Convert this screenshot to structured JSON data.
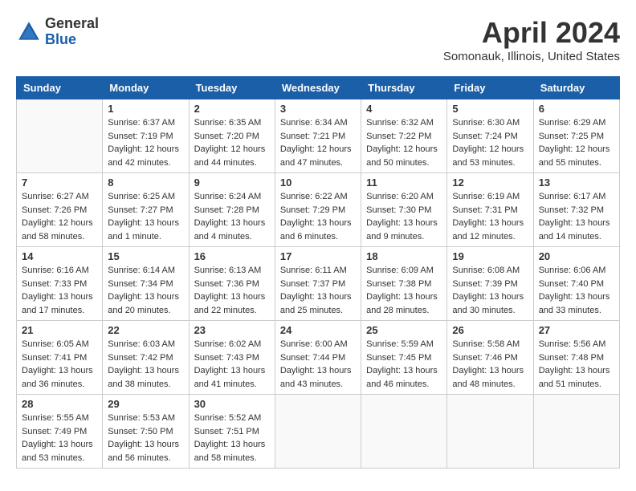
{
  "header": {
    "logo_general": "General",
    "logo_blue": "Blue",
    "month_title": "April 2024",
    "location": "Somonauk, Illinois, United States"
  },
  "days_of_week": [
    "Sunday",
    "Monday",
    "Tuesday",
    "Wednesday",
    "Thursday",
    "Friday",
    "Saturday"
  ],
  "weeks": [
    [
      {
        "day": "",
        "sunrise": "",
        "sunset": "",
        "daylight": ""
      },
      {
        "day": "1",
        "sunrise": "Sunrise: 6:37 AM",
        "sunset": "Sunset: 7:19 PM",
        "daylight": "Daylight: 12 hours and 42 minutes."
      },
      {
        "day": "2",
        "sunrise": "Sunrise: 6:35 AM",
        "sunset": "Sunset: 7:20 PM",
        "daylight": "Daylight: 12 hours and 44 minutes."
      },
      {
        "day": "3",
        "sunrise": "Sunrise: 6:34 AM",
        "sunset": "Sunset: 7:21 PM",
        "daylight": "Daylight: 12 hours and 47 minutes."
      },
      {
        "day": "4",
        "sunrise": "Sunrise: 6:32 AM",
        "sunset": "Sunset: 7:22 PM",
        "daylight": "Daylight: 12 hours and 50 minutes."
      },
      {
        "day": "5",
        "sunrise": "Sunrise: 6:30 AM",
        "sunset": "Sunset: 7:24 PM",
        "daylight": "Daylight: 12 hours and 53 minutes."
      },
      {
        "day": "6",
        "sunrise": "Sunrise: 6:29 AM",
        "sunset": "Sunset: 7:25 PM",
        "daylight": "Daylight: 12 hours and 55 minutes."
      }
    ],
    [
      {
        "day": "7",
        "sunrise": "Sunrise: 6:27 AM",
        "sunset": "Sunset: 7:26 PM",
        "daylight": "Daylight: 12 hours and 58 minutes."
      },
      {
        "day": "8",
        "sunrise": "Sunrise: 6:25 AM",
        "sunset": "Sunset: 7:27 PM",
        "daylight": "Daylight: 13 hours and 1 minute."
      },
      {
        "day": "9",
        "sunrise": "Sunrise: 6:24 AM",
        "sunset": "Sunset: 7:28 PM",
        "daylight": "Daylight: 13 hours and 4 minutes."
      },
      {
        "day": "10",
        "sunrise": "Sunrise: 6:22 AM",
        "sunset": "Sunset: 7:29 PM",
        "daylight": "Daylight: 13 hours and 6 minutes."
      },
      {
        "day": "11",
        "sunrise": "Sunrise: 6:20 AM",
        "sunset": "Sunset: 7:30 PM",
        "daylight": "Daylight: 13 hours and 9 minutes."
      },
      {
        "day": "12",
        "sunrise": "Sunrise: 6:19 AM",
        "sunset": "Sunset: 7:31 PM",
        "daylight": "Daylight: 13 hours and 12 minutes."
      },
      {
        "day": "13",
        "sunrise": "Sunrise: 6:17 AM",
        "sunset": "Sunset: 7:32 PM",
        "daylight": "Daylight: 13 hours and 14 minutes."
      }
    ],
    [
      {
        "day": "14",
        "sunrise": "Sunrise: 6:16 AM",
        "sunset": "Sunset: 7:33 PM",
        "daylight": "Daylight: 13 hours and 17 minutes."
      },
      {
        "day": "15",
        "sunrise": "Sunrise: 6:14 AM",
        "sunset": "Sunset: 7:34 PM",
        "daylight": "Daylight: 13 hours and 20 minutes."
      },
      {
        "day": "16",
        "sunrise": "Sunrise: 6:13 AM",
        "sunset": "Sunset: 7:36 PM",
        "daylight": "Daylight: 13 hours and 22 minutes."
      },
      {
        "day": "17",
        "sunrise": "Sunrise: 6:11 AM",
        "sunset": "Sunset: 7:37 PM",
        "daylight": "Daylight: 13 hours and 25 minutes."
      },
      {
        "day": "18",
        "sunrise": "Sunrise: 6:09 AM",
        "sunset": "Sunset: 7:38 PM",
        "daylight": "Daylight: 13 hours and 28 minutes."
      },
      {
        "day": "19",
        "sunrise": "Sunrise: 6:08 AM",
        "sunset": "Sunset: 7:39 PM",
        "daylight": "Daylight: 13 hours and 30 minutes."
      },
      {
        "day": "20",
        "sunrise": "Sunrise: 6:06 AM",
        "sunset": "Sunset: 7:40 PM",
        "daylight": "Daylight: 13 hours and 33 minutes."
      }
    ],
    [
      {
        "day": "21",
        "sunrise": "Sunrise: 6:05 AM",
        "sunset": "Sunset: 7:41 PM",
        "daylight": "Daylight: 13 hours and 36 minutes."
      },
      {
        "day": "22",
        "sunrise": "Sunrise: 6:03 AM",
        "sunset": "Sunset: 7:42 PM",
        "daylight": "Daylight: 13 hours and 38 minutes."
      },
      {
        "day": "23",
        "sunrise": "Sunrise: 6:02 AM",
        "sunset": "Sunset: 7:43 PM",
        "daylight": "Daylight: 13 hours and 41 minutes."
      },
      {
        "day": "24",
        "sunrise": "Sunrise: 6:00 AM",
        "sunset": "Sunset: 7:44 PM",
        "daylight": "Daylight: 13 hours and 43 minutes."
      },
      {
        "day": "25",
        "sunrise": "Sunrise: 5:59 AM",
        "sunset": "Sunset: 7:45 PM",
        "daylight": "Daylight: 13 hours and 46 minutes."
      },
      {
        "day": "26",
        "sunrise": "Sunrise: 5:58 AM",
        "sunset": "Sunset: 7:46 PM",
        "daylight": "Daylight: 13 hours and 48 minutes."
      },
      {
        "day": "27",
        "sunrise": "Sunrise: 5:56 AM",
        "sunset": "Sunset: 7:48 PM",
        "daylight": "Daylight: 13 hours and 51 minutes."
      }
    ],
    [
      {
        "day": "28",
        "sunrise": "Sunrise: 5:55 AM",
        "sunset": "Sunset: 7:49 PM",
        "daylight": "Daylight: 13 hours and 53 minutes."
      },
      {
        "day": "29",
        "sunrise": "Sunrise: 5:53 AM",
        "sunset": "Sunset: 7:50 PM",
        "daylight": "Daylight: 13 hours and 56 minutes."
      },
      {
        "day": "30",
        "sunrise": "Sunrise: 5:52 AM",
        "sunset": "Sunset: 7:51 PM",
        "daylight": "Daylight: 13 hours and 58 minutes."
      },
      {
        "day": "",
        "sunrise": "",
        "sunset": "",
        "daylight": ""
      },
      {
        "day": "",
        "sunrise": "",
        "sunset": "",
        "daylight": ""
      },
      {
        "day": "",
        "sunrise": "",
        "sunset": "",
        "daylight": ""
      },
      {
        "day": "",
        "sunrise": "",
        "sunset": "",
        "daylight": ""
      }
    ]
  ]
}
